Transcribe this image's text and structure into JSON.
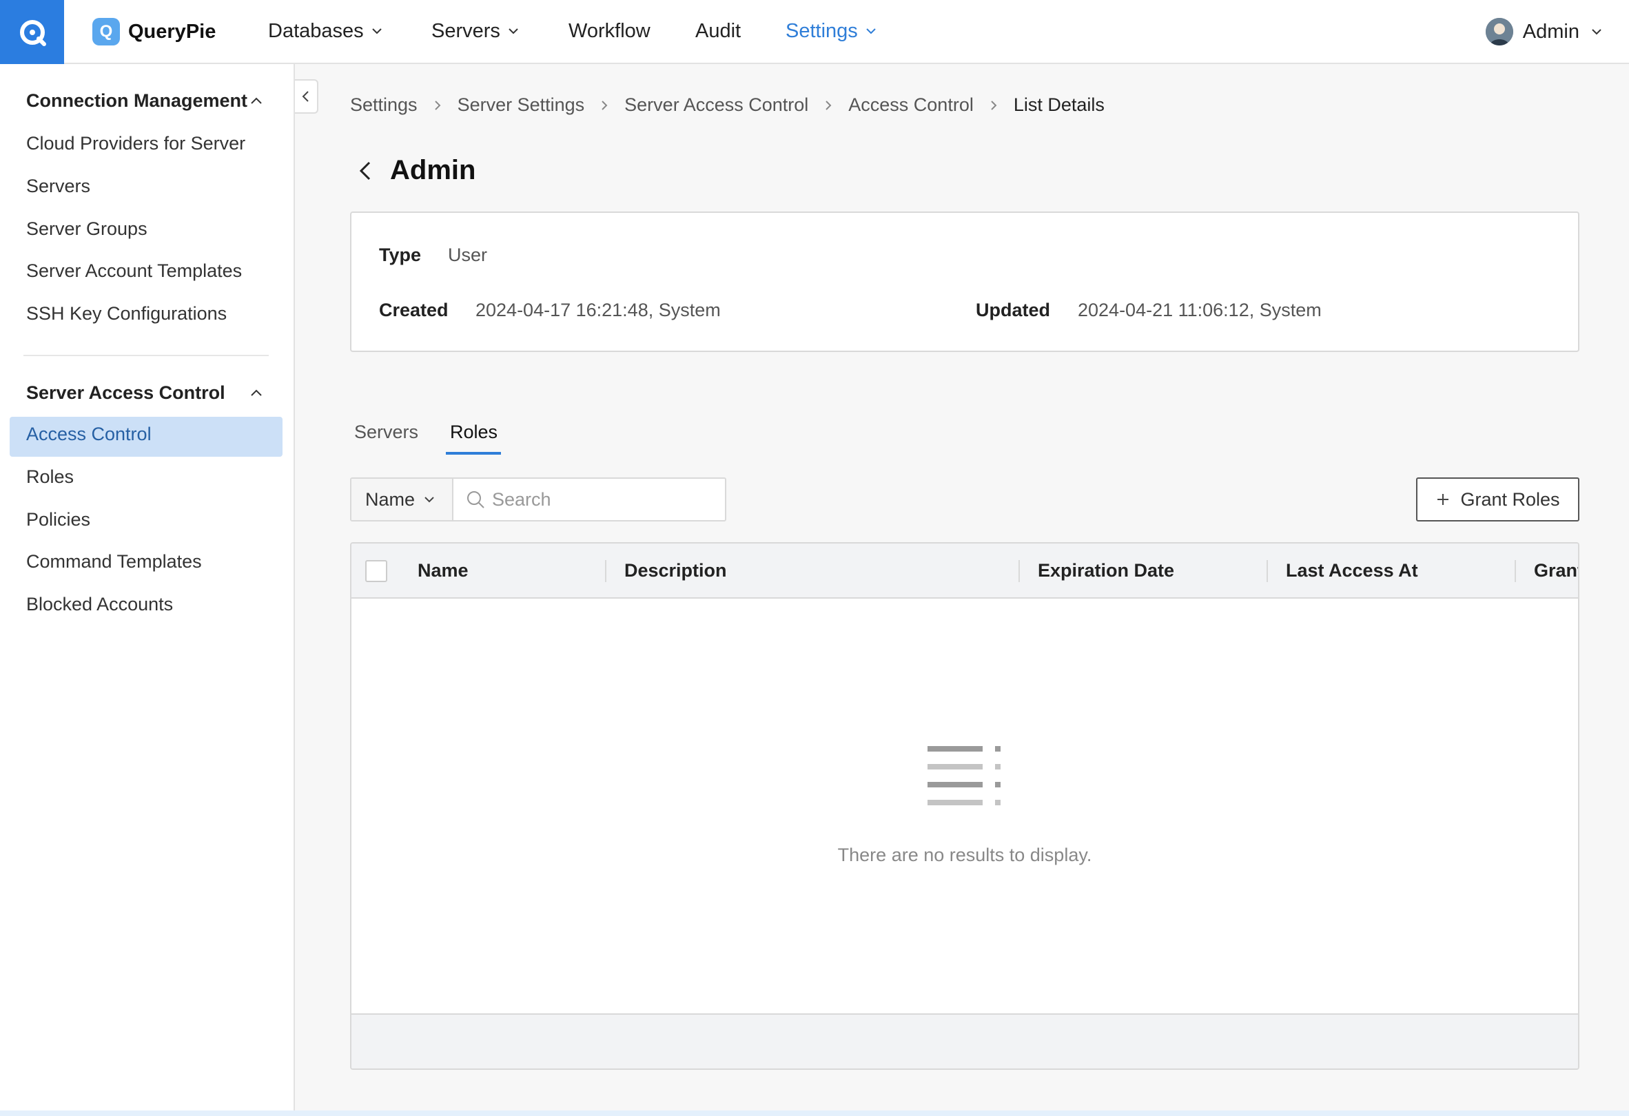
{
  "app": {
    "brand": "QueryPie",
    "brand_mark": "Q"
  },
  "topnav": {
    "items": [
      {
        "label": "Databases",
        "has_menu": true
      },
      {
        "label": "Servers",
        "has_menu": true
      },
      {
        "label": "Workflow",
        "has_menu": false
      },
      {
        "label": "Audit",
        "has_menu": false
      },
      {
        "label": "Settings",
        "has_menu": true,
        "active": true
      }
    ],
    "user": {
      "name": "Admin"
    }
  },
  "sidebar": {
    "groups": [
      {
        "title": "Connection Management",
        "items": [
          "Cloud Providers for Server",
          "Servers",
          "Server Groups",
          "Server Account Templates",
          "SSH Key Configurations"
        ]
      },
      {
        "title": "Server Access Control",
        "items": [
          "Access Control",
          "Roles",
          "Policies",
          "Command Templates",
          "Blocked Accounts"
        ],
        "active_item": "Access Control"
      }
    ]
  },
  "breadcrumb": [
    "Settings",
    "Server Settings",
    "Server Access Control",
    "Access Control",
    "List Details"
  ],
  "page": {
    "title": "Admin"
  },
  "info": {
    "type_label": "Type",
    "type_value": "User",
    "created_label": "Created",
    "created_value": "2024-04-17 16:21:48, System",
    "updated_label": "Updated",
    "updated_value": "2024-04-21 11:06:12, System"
  },
  "tabs": [
    {
      "label": "Servers"
    },
    {
      "label": "Roles",
      "active": true
    }
  ],
  "filter": {
    "field": "Name",
    "search_placeholder": "Search"
  },
  "actions": {
    "grant_roles": "Grant Roles"
  },
  "table": {
    "columns": [
      "Name",
      "Description",
      "Expiration Date",
      "Last Access At",
      "Granted"
    ],
    "rows": [],
    "empty_text": "There are no results to display."
  },
  "colors": {
    "accent": "#2f7ed8",
    "logo_bg": "#2b7de0",
    "active_item_bg": "#cce0f7"
  }
}
